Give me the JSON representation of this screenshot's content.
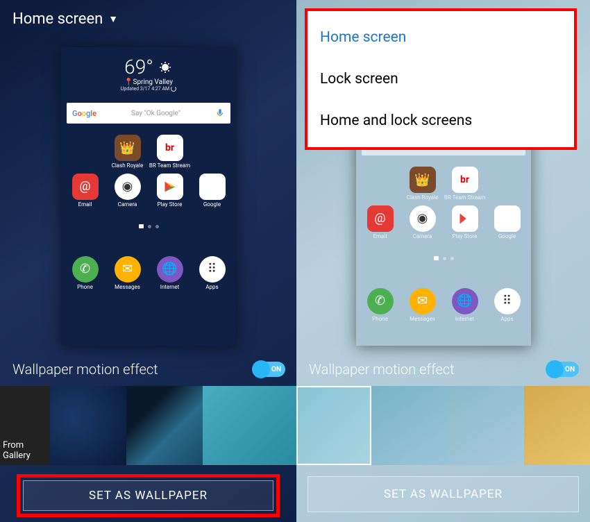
{
  "header": {
    "title": "Home screen"
  },
  "dropdown": {
    "items": [
      {
        "label": "Home screen",
        "active": true
      },
      {
        "label": "Lock screen"
      },
      {
        "label": "Home and lock screens"
      }
    ]
  },
  "preview": {
    "weather": {
      "temp": "69°",
      "location": "Spring Valley",
      "updated": "Updated 3/17 4:27 AM"
    },
    "search": {
      "logo": "Google",
      "placeholder": "Say \"Ok Google\""
    },
    "apps_row1": [
      {
        "label": "Clash Royale",
        "cls": "i-clash",
        "glyph": "👑"
      },
      {
        "label": "BR Team Stream",
        "cls": "i-br",
        "glyph": "br"
      }
    ],
    "apps_row2": [
      {
        "label": "Email",
        "cls": "i-email",
        "glyph": "@"
      },
      {
        "label": "Camera",
        "cls": "i-camera",
        "glyph": "◉"
      },
      {
        "label": "Play Store",
        "cls": "i-play",
        "glyph": "▶"
      },
      {
        "label": "Google",
        "cls": "i-google",
        "glyph": "⊞"
      }
    ],
    "apps_home": [
      {
        "label": "Phone",
        "cls": "i-phone",
        "glyph": "✆"
      },
      {
        "label": "Messages",
        "cls": "i-msg",
        "glyph": "✉"
      },
      {
        "label": "Internet",
        "cls": "i-internet",
        "glyph": "🌐"
      },
      {
        "label": "Apps",
        "cls": "i-apps",
        "glyph": "⣿"
      }
    ]
  },
  "motion": {
    "label": "Wallpaper motion effect",
    "state": "ON"
  },
  "gallery": {
    "label": "From Gallery"
  },
  "button": {
    "label": "SET AS WALLPAPER"
  }
}
